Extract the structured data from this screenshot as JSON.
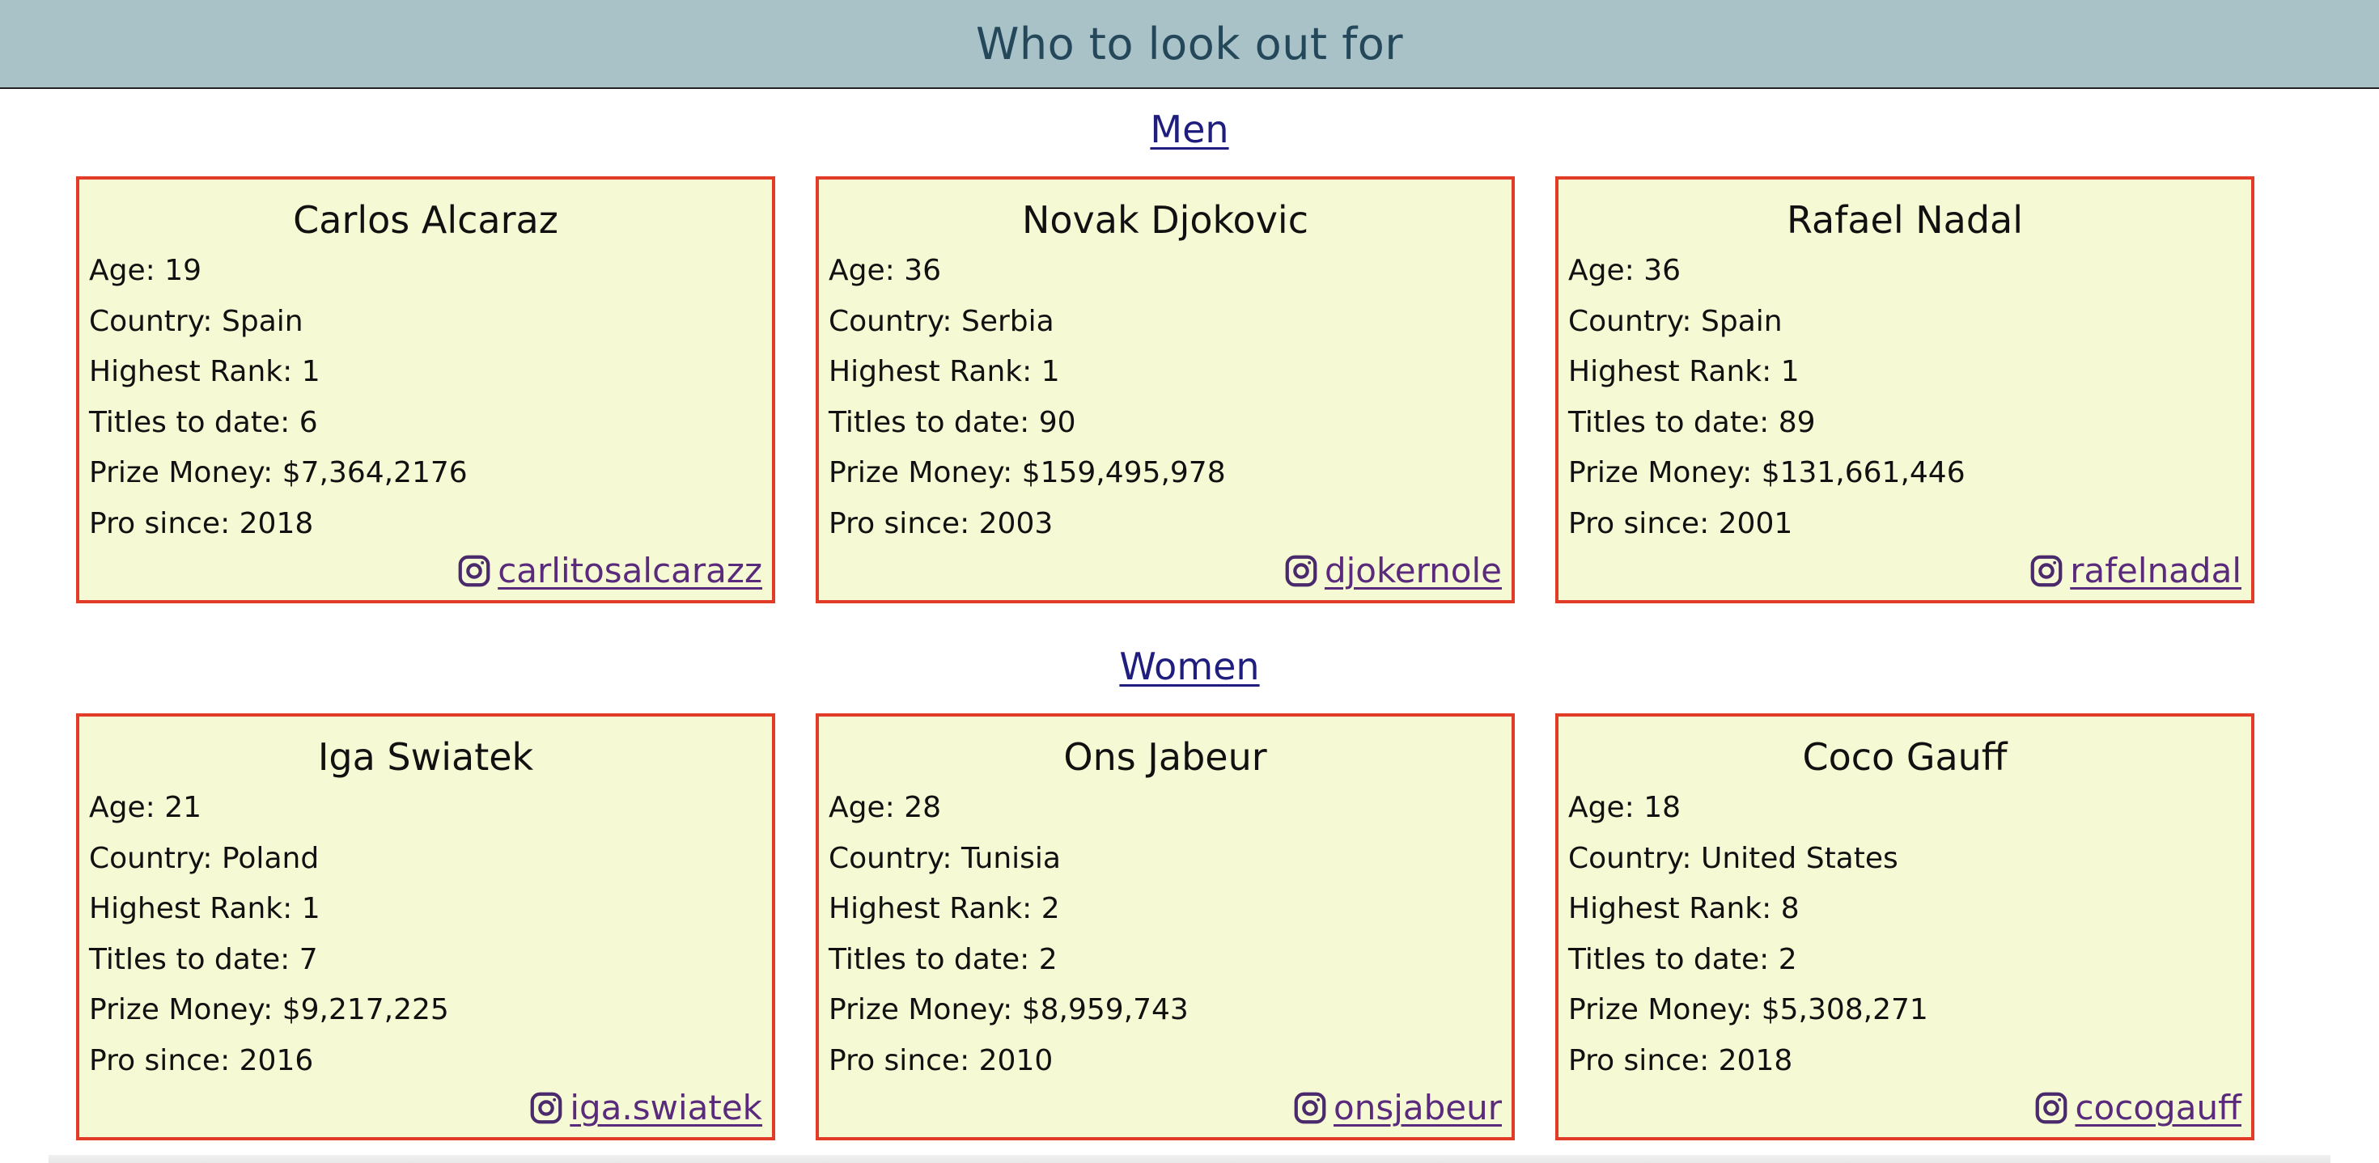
{
  "header": {
    "title": "Who to look out for"
  },
  "colors": {
    "header_bg": "#a8c2c8",
    "header_text": "#24485a",
    "card_bg": "#f5fad4",
    "card_border": "#e23b28",
    "section_link": "#1f1d7e",
    "social_link": "#5a2a7c"
  },
  "labels": {
    "age": "Age:",
    "country": "Country:",
    "rank": "Highest Rank:",
    "titles": "Titles to date:",
    "prize": "Prize Money:",
    "pro": "Pro since:"
  },
  "sections": [
    {
      "heading": "Men",
      "players": [
        {
          "name": "Carlos Alcaraz",
          "age": "19",
          "country": "Spain",
          "rank": "1",
          "titles": "6",
          "prize": "$7,364,2176",
          "pro": "2018",
          "instagram": "carlitosalcarazz",
          "icon": "instagram-icon"
        },
        {
          "name": "Novak Djokovic",
          "age": "36",
          "country": "Serbia",
          "rank": "1",
          "titles": "90",
          "prize": "$159,495,978",
          "pro": "2003",
          "instagram": "djokernole",
          "icon": "instagram-icon"
        },
        {
          "name": "Rafael Nadal",
          "age": "36",
          "country": "Spain",
          "rank": "1",
          "titles": "89",
          "prize": "$131,661,446",
          "pro": "2001",
          "instagram": "rafelnadal",
          "icon": "instagram-icon"
        }
      ]
    },
    {
      "heading": "Women",
      "players": [
        {
          "name": "Iga Swiatek",
          "age": "21",
          "country": "Poland",
          "rank": "1",
          "titles": "7",
          "prize": "$9,217,225",
          "pro": "2016",
          "instagram": "iga.swiatek",
          "icon": "instagram-icon"
        },
        {
          "name": "Ons Jabeur",
          "age": "28",
          "country": "Tunisia",
          "rank": "2",
          "titles": "2",
          "prize": "$8,959,743",
          "pro": "2010",
          "instagram": "onsjabeur",
          "icon": "instagram-icon"
        },
        {
          "name": "Coco Gauff",
          "age": "18",
          "country": "United States",
          "rank": "8",
          "titles": "2",
          "prize": "$5,308,271",
          "pro": "2018",
          "instagram": "cocogauff",
          "icon": "instagram-icon"
        }
      ]
    }
  ]
}
